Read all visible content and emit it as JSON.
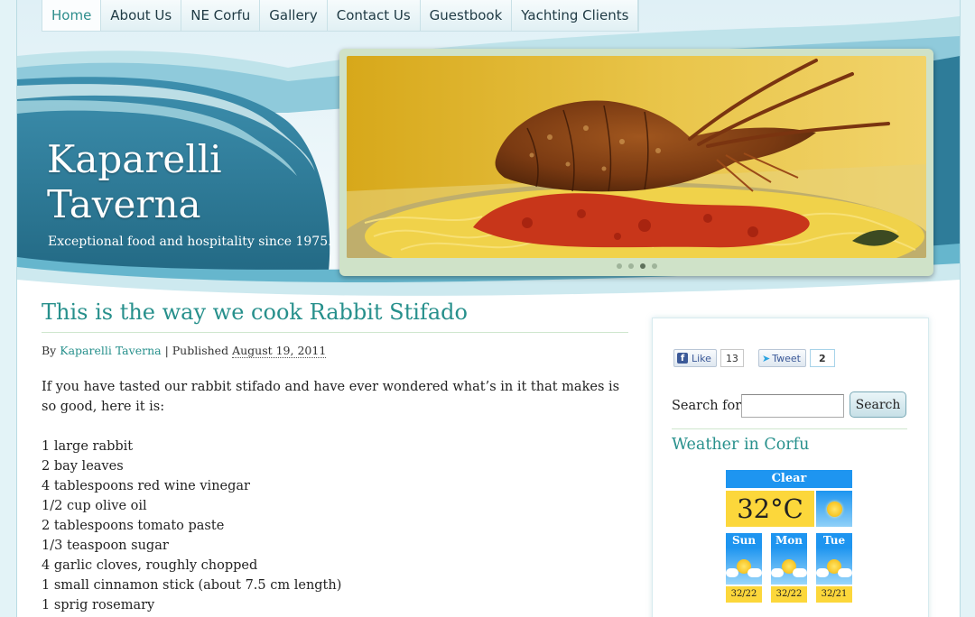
{
  "nav": {
    "items": [
      {
        "label": "Home",
        "active": true
      },
      {
        "label": "About Us"
      },
      {
        "label": "NE Corfu"
      },
      {
        "label": "Gallery"
      },
      {
        "label": "Contact Us"
      },
      {
        "label": "Guestbook"
      },
      {
        "label": "Yachting Clients"
      }
    ]
  },
  "site": {
    "title_line1": "Kaparelli",
    "title_line2": "Taverna",
    "tagline": "Exceptional food and hospitality since 1975."
  },
  "slider": {
    "image": "lobster-spaghetti-photo",
    "dots": 4,
    "active_dot": 3
  },
  "post": {
    "title": "This is the way we cook Rabbit Stifado",
    "by_label": "By",
    "author": "Kaparelli Taverna",
    "published_label": "| Published",
    "date": "August 19, 2011",
    "intro": "If you have tasted our rabbit stifado and have ever wondered what’s in it that makes is so good, here it is:",
    "ingredients": [
      "1 large rabbit",
      "2 bay leaves",
      "4 tablespoons red wine vinegar",
      "1/2 cup olive oil",
      "2 tablespoons tomato paste",
      "1/3 teaspoon sugar",
      "4 garlic cloves, roughly chopped",
      "1 small cinnamon stick (about 7.5 cm length)",
      "1 sprig rosemary"
    ]
  },
  "sidebar": {
    "facebook": {
      "label": "Like",
      "count": "13"
    },
    "twitter": {
      "label": "Tweet",
      "count": "2"
    },
    "search": {
      "label": "Search for:",
      "value": "",
      "button": "Search"
    },
    "weather": {
      "title": "Weather in Corfu",
      "condition": "Clear",
      "temperature": "32°C",
      "forecast": [
        {
          "day": "Sun",
          "range": "32/22"
        },
        {
          "day": "Mon",
          "range": "32/22"
        },
        {
          "day": "Tue",
          "range": "32/21"
        }
      ]
    }
  },
  "colors": {
    "accent_teal": "#27908c",
    "header_blue": "#2c7b98",
    "weather_blue": "#1e95f0",
    "weather_yellow": "#fcd73b"
  }
}
